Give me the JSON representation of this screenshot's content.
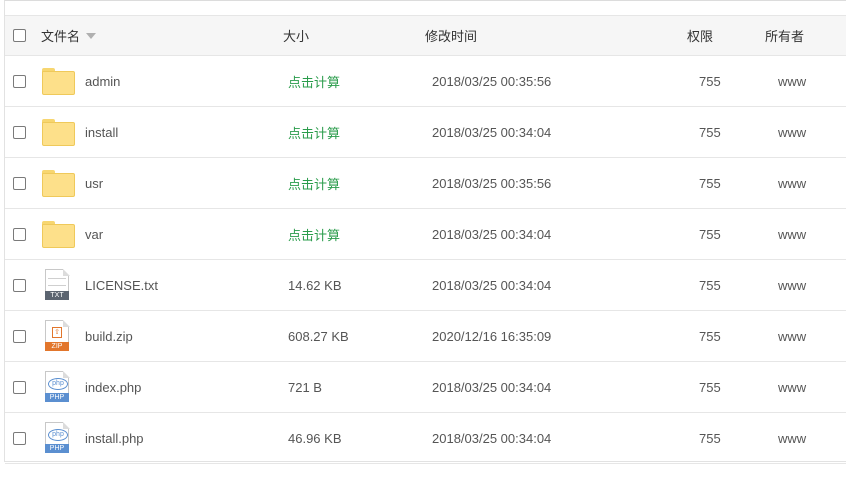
{
  "header": {
    "name": "文件名",
    "size": "大小",
    "mtime": "修改时间",
    "perm": "权限",
    "owner": "所有者"
  },
  "files": [
    {
      "name": "admin",
      "type": "folder",
      "size": "点击计算",
      "mtime": "2018/03/25 00:35:56",
      "perm": "755",
      "owner": "www"
    },
    {
      "name": "install",
      "type": "folder",
      "size": "点击计算",
      "mtime": "2018/03/25 00:34:04",
      "perm": "755",
      "owner": "www"
    },
    {
      "name": "usr",
      "type": "folder",
      "size": "点击计算",
      "mtime": "2018/03/25 00:35:56",
      "perm": "755",
      "owner": "www"
    },
    {
      "name": "var",
      "type": "folder",
      "size": "点击计算",
      "mtime": "2018/03/25 00:34:04",
      "perm": "755",
      "owner": "www"
    },
    {
      "name": "LICENSE.txt",
      "type": "txt",
      "ext": "TXT",
      "size": "14.62 KB",
      "mtime": "2018/03/25 00:34:04",
      "perm": "755",
      "owner": "www"
    },
    {
      "name": "build.zip",
      "type": "zip",
      "ext": "ZIP",
      "size": "608.27 KB",
      "mtime": "2020/12/16 16:35:09",
      "perm": "755",
      "owner": "www"
    },
    {
      "name": "index.php",
      "type": "php",
      "ext": "PHP",
      "size": "721 B",
      "mtime": "2018/03/25 00:34:04",
      "perm": "755",
      "owner": "www"
    },
    {
      "name": "install.php",
      "type": "php",
      "ext": "PHP",
      "size": "46.96 KB",
      "mtime": "2018/03/25 00:34:04",
      "perm": "755",
      "owner": "www"
    }
  ],
  "colors": {
    "calc_link": "#2a9c4b",
    "txt_band": "#5b6470",
    "zip_band": "#e2762c",
    "php_band": "#5b8fd0"
  }
}
